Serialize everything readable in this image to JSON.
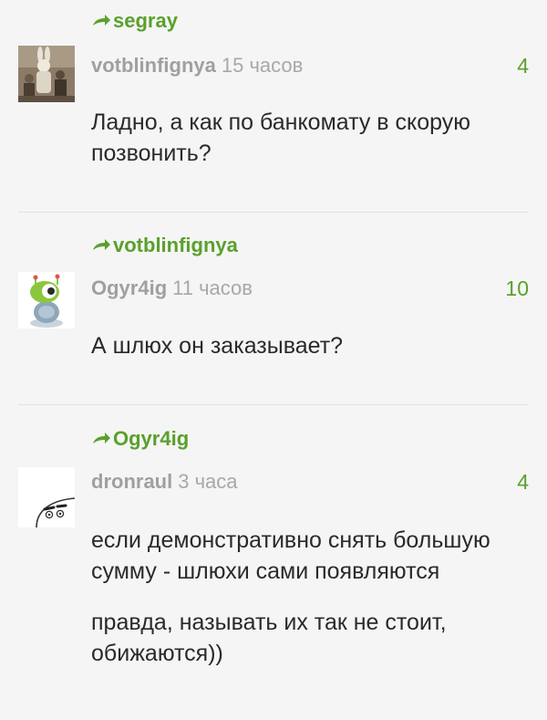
{
  "comments": [
    {
      "reply_to": "segray",
      "author": "votblinfignya",
      "time": "15 часов",
      "rating": "4",
      "paragraphs": [
        "Ладно, а как по банкомату в скорую позвонить?"
      ],
      "avatar_icon": "photo-avatar-icon"
    },
    {
      "reply_to": "votblinfignya",
      "author": "Ogyr4ig",
      "time": "11 часов",
      "rating": "10",
      "paragraphs": [
        "А шлюх он заказывает?"
      ],
      "avatar_icon": "alien-avatar-icon"
    },
    {
      "reply_to": "Ogyr4ig",
      "author": "dronraul",
      "time": "3 часа",
      "rating": "4",
      "paragraphs": [
        "если демонстративно снять большую сумму - шлюхи сами появляются",
        "правда, называть их так не стоит, обижаются))"
      ],
      "avatar_icon": "face-avatar-icon"
    }
  ],
  "colors": {
    "accent": "#5aa02c",
    "meta": "#a0a0a0",
    "text": "#2a2a2a",
    "background": "#f5f5f5"
  }
}
